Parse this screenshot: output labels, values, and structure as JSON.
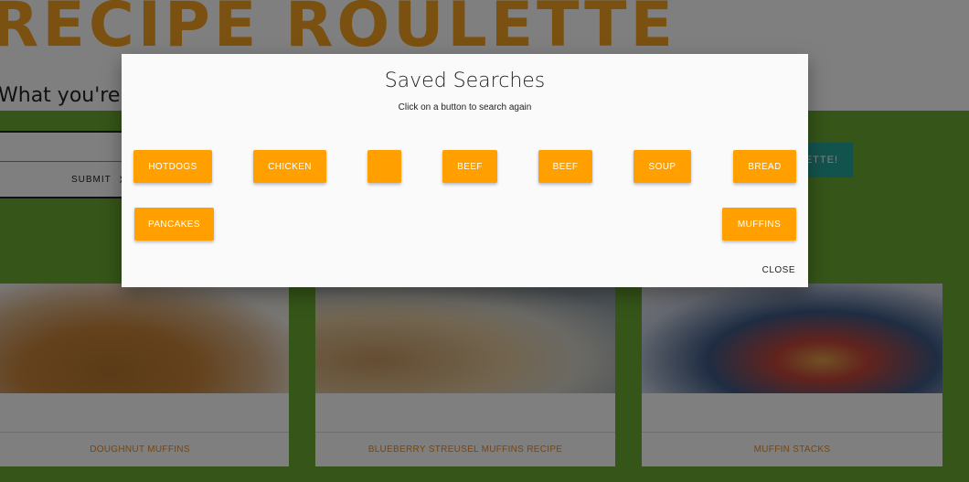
{
  "header": {
    "title": "RECIPE ROULETTE",
    "tagline": "What you're craving will appear here"
  },
  "search": {
    "submit_label": "SUBMIT",
    "submit_icon": "send-icon"
  },
  "roulette_button": {
    "label": "ROULETTE!"
  },
  "cards": [
    {
      "title": "DOUGHNUT MUFFINS"
    },
    {
      "title": "BLUEBERRY STREUSEL MUFFINS RECIPE"
    },
    {
      "title": "MUFFIN STACKS"
    }
  ],
  "modal": {
    "title": "Saved Searches",
    "subtitle": "Click on a button to search again",
    "searches": [
      "HOTDOGS",
      "CHICKEN",
      "",
      "BEEF",
      "BEEF",
      "SOUP",
      "BREAD",
      "PANCAKES",
      "MUFFINS"
    ],
    "close_label": "CLOSE",
    "colors": {
      "chip": "#ffa000",
      "chip_text": "#ffffff"
    }
  },
  "colors": {
    "brand_orange": "#f6a323",
    "page_green": "#6aaa33",
    "teal": "#26a69a"
  }
}
